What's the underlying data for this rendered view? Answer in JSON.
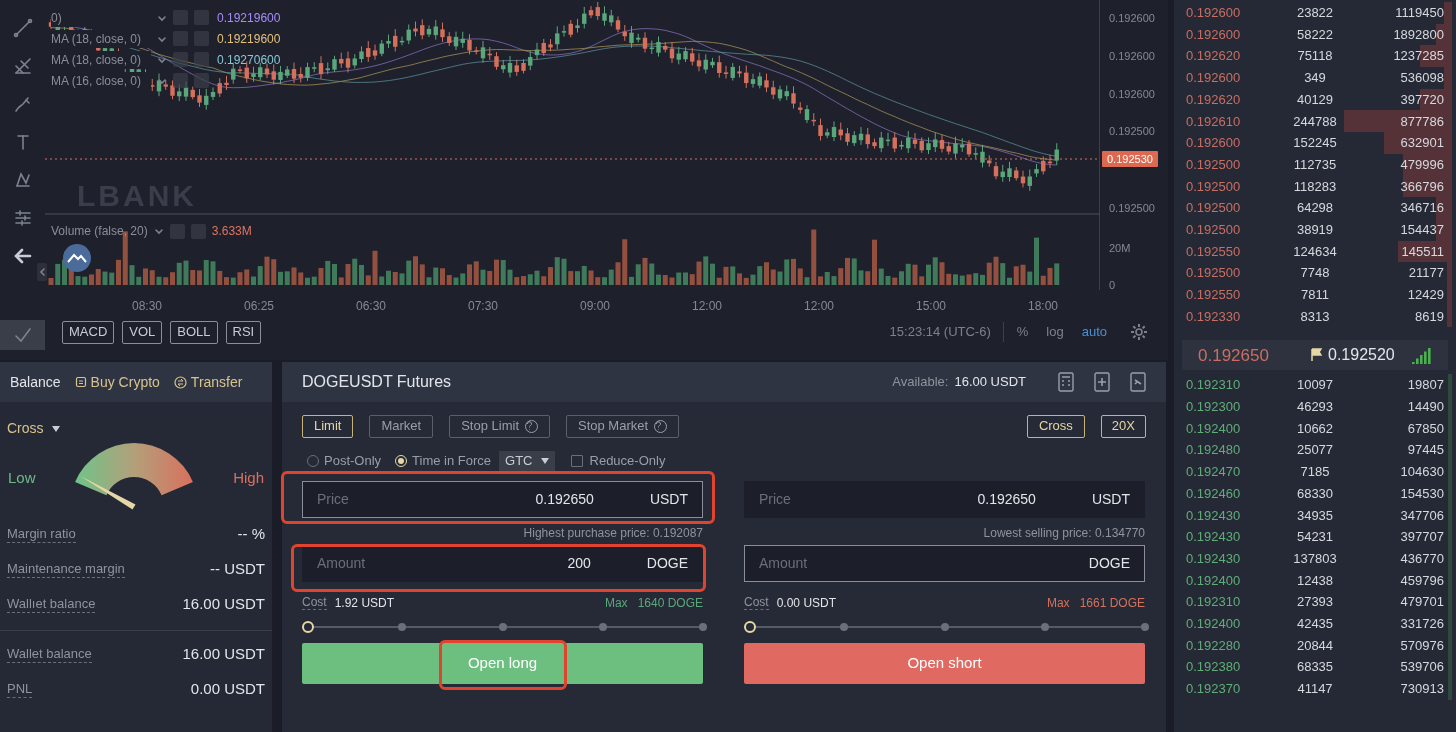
{
  "chart": {
    "indicators": [
      {
        "label": "0)",
        "value": "0.19219600",
        "color": "#a78bfa"
      },
      {
        "label": "MA (18, close, 0)",
        "value": "0.19219600",
        "color": "#e5c07b"
      },
      {
        "label": "MA (18, close, 0)",
        "value": "0.19270600",
        "color": "#86c7d6"
      },
      {
        "label": "MA (16, close, 0)"
      }
    ],
    "logo_text": "LBANK",
    "price_ticks": [
      "0.192600",
      "0.192600",
      "0.192600",
      "0.192500",
      "0.192500"
    ],
    "last_price": "0.192530",
    "volume": {
      "label": "Volume (false, 20)",
      "value": "3.633M"
    },
    "volume_ticks": [
      "20M",
      "0"
    ],
    "time_ticks": [
      "08:30",
      "06:25",
      "06:30",
      "07:30",
      "09:00",
      "12:00",
      "12:00",
      "15:00",
      "18:00"
    ],
    "study_buttons": [
      "MACD",
      "VOL",
      "BOLL",
      "RSI"
    ],
    "clock": "15:23:14 (UTC-6)",
    "scale_options": [
      {
        "label": "%",
        "selected": false
      },
      {
        "label": "log",
        "selected": false
      },
      {
        "label": "auto",
        "selected": true
      }
    ]
  },
  "balance": {
    "tabs": [
      {
        "label": "Balance",
        "selected": true
      },
      {
        "label": "Buy Crypto",
        "selected": false
      },
      {
        "label": "Transfer",
        "selected": false
      }
    ],
    "mode": "Cross",
    "gauge": {
      "low": "Low",
      "high": "High"
    },
    "rows": [
      {
        "label": "Margin ratio",
        "value": "-- %"
      },
      {
        "label": "Maintenance margin",
        "value": "-- USDT"
      },
      {
        "label": "Wallıet balance",
        "value": "16.00 USDT"
      }
    ],
    "summary": [
      {
        "label": "Wallet balance",
        "value": "16.00 USDT"
      },
      {
        "label": "PNL",
        "value": "0.00 USDT"
      }
    ]
  },
  "order_form": {
    "title": "DOGEUSDT Futures",
    "available_label": "Available:",
    "available": "16.00 USDT",
    "order_types": [
      {
        "label": "Limit",
        "selected": true,
        "help": false
      },
      {
        "label": "Market",
        "selected": false,
        "help": false
      },
      {
        "label": "Stop Limit",
        "selected": false,
        "help": true
      },
      {
        "label": "Stop Market",
        "selected": false,
        "help": true
      }
    ],
    "margin_mode": "Cross",
    "leverage": "20X",
    "options": [
      {
        "kind": "radio",
        "label": "Post-Only",
        "checked": false
      },
      {
        "kind": "radio",
        "label": "Time in Force",
        "checked": true
      },
      {
        "kind": "select",
        "value": "GTC"
      },
      {
        "kind": "checkbox",
        "label": "Reduce-Only",
        "checked": false
      }
    ],
    "sides": [
      {
        "kind": "buy",
        "price": {
          "placeholder": "Price",
          "value": "0.192650",
          "unit": "USDT",
          "focused": true,
          "highlight": true
        },
        "limit_note": "Highest purchase price: 0.192087",
        "amount": {
          "placeholder": "Amount",
          "value": "200",
          "unit": "DOGE",
          "focused": false,
          "highlight": true
        },
        "cost_label": "Cost",
        "cost": "1.92 USDT",
        "max_label": "Max",
        "max": "1640 DOGE",
        "slider": {
          "level": 0
        },
        "button": {
          "label": "Open long",
          "highlight": true
        }
      },
      {
        "kind": "sell",
        "price": {
          "placeholder": "Price",
          "value": "0.192650",
          "unit": "USDT",
          "focused": false,
          "highlight": false
        },
        "limit_note": "Lowest selling price: 0.134770",
        "amount": {
          "placeholder": "Amount",
          "unit": "DOGE",
          "focused": true,
          "highlight": false
        },
        "cost_label": "Cost",
        "cost": "0.00 USDT",
        "max_label": "Max",
        "max": "1661 DOGE",
        "slider": {
          "level": 0
        },
        "button": {
          "label": "Open short",
          "highlight": false
        }
      }
    ]
  },
  "order_book": {
    "asks": [
      {
        "price": "0.192600",
        "amount": "23822",
        "total": "1119450"
      },
      {
        "price": "0.192600",
        "amount": "58222",
        "total": "1892800"
      },
      {
        "price": "0.192620",
        "amount": "75118",
        "total": "1237285"
      },
      {
        "price": "0.192600",
        "amount": "349",
        "total": "536098"
      },
      {
        "price": "0.192620",
        "amount": "40129",
        "total": "397720"
      },
      {
        "price": "0.192610",
        "amount": "244788",
        "total": "877786"
      },
      {
        "price": "0.192600",
        "amount": "152245",
        "total": "632901"
      },
      {
        "price": "0.192500",
        "amount": "112735",
        "total": "479996"
      },
      {
        "price": "0.192500",
        "amount": "118283",
        "total": "366796"
      },
      {
        "price": "0.192500",
        "amount": "64298",
        "total": "346716"
      },
      {
        "price": "0.192500",
        "amount": "38919",
        "total": "154437"
      },
      {
        "price": "0.192550",
        "amount": "124634",
        "total": "145511"
      },
      {
        "price": "0.192500",
        "amount": "7748",
        "total": "21177"
      },
      {
        "price": "0.192550",
        "amount": "7811",
        "total": "12429"
      },
      {
        "price": "0.192330",
        "amount": "8313",
        "total": "8619"
      }
    ],
    "last": "0.192650",
    "mark": "0.192520",
    "bids": [
      {
        "price": "0.192310",
        "amount": "10097",
        "total": "19807"
      },
      {
        "price": "0.192300",
        "amount": "46293",
        "total": "14490"
      },
      {
        "price": "0.192400",
        "amount": "10662",
        "total": "67850"
      },
      {
        "price": "0.192480",
        "amount": "25077",
        "total": "97445"
      },
      {
        "price": "0.192470",
        "amount": "7185",
        "total": "104630"
      },
      {
        "price": "0.192460",
        "amount": "68330",
        "total": "154530"
      },
      {
        "price": "0.192430",
        "amount": "34935",
        "total": "347706"
      },
      {
        "price": "0.192430",
        "amount": "54231",
        "total": "397707"
      },
      {
        "price": "0.192430",
        "amount": "137803",
        "total": "436770"
      },
      {
        "price": "0.192400",
        "amount": "12438",
        "total": "459796"
      },
      {
        "price": "0.192310",
        "amount": "27393",
        "total": "479701"
      },
      {
        "price": "0.192400",
        "amount": "42435",
        "total": "331726"
      },
      {
        "price": "0.192280",
        "amount": "20844",
        "total": "570976"
      },
      {
        "price": "0.192380",
        "amount": "68335",
        "total": "539706"
      },
      {
        "price": "0.192370",
        "amount": "41147",
        "total": "730913"
      }
    ]
  }
}
